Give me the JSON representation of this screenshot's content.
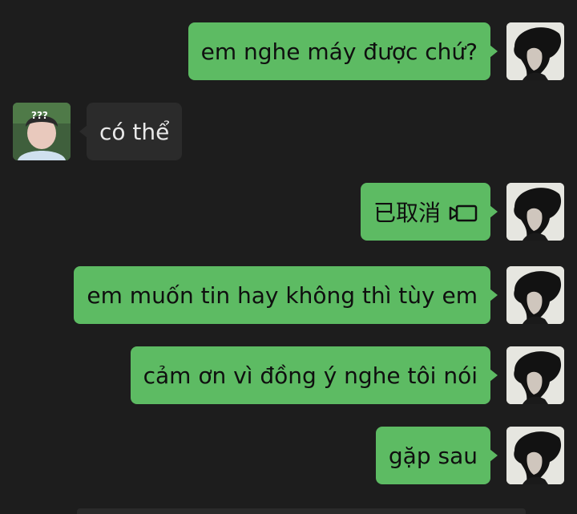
{
  "messages": [
    {
      "sender": "self",
      "text": "em nghe máy được chứ?"
    },
    {
      "sender": "other",
      "text": "có thể",
      "avatar_badge": "???"
    },
    {
      "sender": "self",
      "text": "已取消",
      "icon": "video-call-icon"
    },
    {
      "sender": "self",
      "text": "em muốn tin hay không thì tùy em"
    },
    {
      "sender": "self",
      "text": "cảm ơn vì đồng ý nghe tôi nói"
    },
    {
      "sender": "self",
      "text": "gặp sau"
    }
  ],
  "colors": {
    "background": "#1d1d1d",
    "self_bubble": "#5dbb63",
    "other_bubble": "#2b2b2b"
  }
}
